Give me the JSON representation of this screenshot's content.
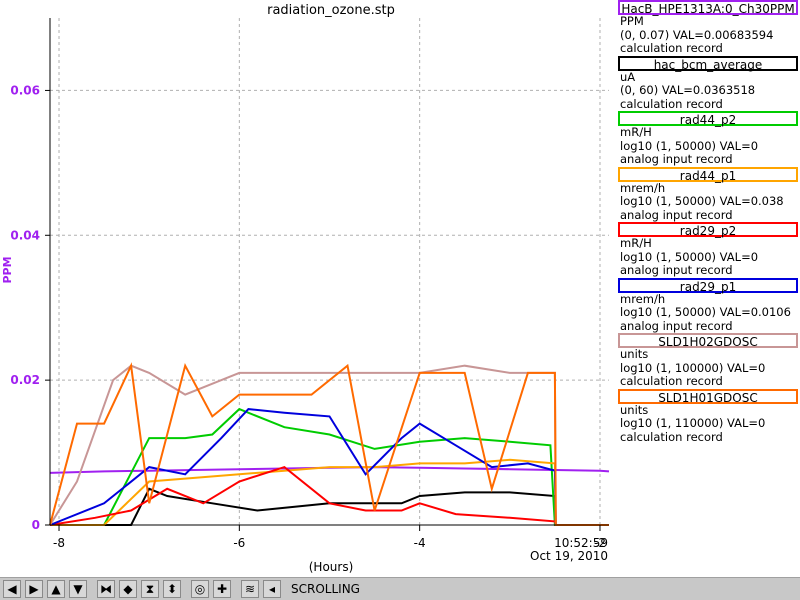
{
  "chart_data": {
    "type": "line",
    "title": "radiation_ozone.stp",
    "xlabel": "(Hours)",
    "ylabel": "PPM",
    "xlim": [
      -8.1,
      -1.9
    ],
    "ylim": [
      0,
      0.07
    ],
    "x_ticks": [
      -8,
      -6,
      -4,
      -2
    ],
    "x_tick_labels": [
      "-8",
      "-6",
      "-4",
      "-2"
    ],
    "y_ticks": [
      0,
      0.02,
      0.04,
      0.06
    ],
    "y_tick_labels": [
      "0",
      "0.02",
      "0.04",
      "0.06"
    ],
    "time_label": "10:52:59",
    "date_label": "Oct 19, 2010",
    "grid": true,
    "legend_position": "right",
    "series": [
      {
        "name": "HacB_HPE1313A:0_Ch30PPM",
        "color": "#a020f0",
        "x": [
          -8.1,
          -7.5,
          -7.0,
          -6.5,
          -6.0,
          -5.5,
          -5.0,
          -4.5,
          -4.0,
          -3.5,
          -3.0,
          -2.5,
          -2.0,
          -1.9
        ],
        "y": [
          0.0072,
          0.0074,
          0.0075,
          0.0076,
          0.0077,
          0.0078,
          0.0079,
          0.008,
          0.0079,
          0.0078,
          0.0077,
          0.0076,
          0.0075,
          0.0074
        ]
      },
      {
        "name": "hac_bcm_average",
        "color": "#000000",
        "x": [
          -8.1,
          -7.2,
          -7.0,
          -6.8,
          -6.3,
          -5.8,
          -5.0,
          -4.2,
          -4.0,
          -3.5,
          -3.0,
          -2.5,
          -2.49,
          -1.9
        ],
        "y": [
          0.0,
          0.0,
          0.005,
          0.004,
          0.003,
          0.002,
          0.003,
          0.003,
          0.004,
          0.0045,
          0.0045,
          0.004,
          0.0,
          0.0
        ]
      },
      {
        "name": "rad44_p2",
        "color": "#00cc00",
        "x": [
          -8.1,
          -7.5,
          -7.0,
          -6.6,
          -6.3,
          -6.0,
          -5.5,
          -5.0,
          -4.5,
          -4.0,
          -3.5,
          -3.0,
          -2.55,
          -2.5,
          -1.9
        ],
        "y": [
          0.0,
          0.0,
          0.012,
          0.012,
          0.0125,
          0.016,
          0.0135,
          0.0125,
          0.0105,
          0.0115,
          0.012,
          0.0115,
          0.011,
          0.0,
          0.0
        ]
      },
      {
        "name": "rad44_p1",
        "color": "#ffa500",
        "x": [
          -8.1,
          -7.5,
          -7.0,
          -6.5,
          -6.0,
          -5.5,
          -5.0,
          -4.5,
          -4.0,
          -3.5,
          -3.0,
          -2.5,
          -2.49,
          -1.9
        ],
        "y": [
          0.0,
          0.0,
          0.006,
          0.0065,
          0.007,
          0.0075,
          0.008,
          0.008,
          0.0085,
          0.0085,
          0.009,
          0.0085,
          0.0,
          0.0
        ]
      },
      {
        "name": "rad29_p2",
        "color": "#ff0000",
        "x": [
          -8.1,
          -7.6,
          -7.2,
          -6.8,
          -6.4,
          -6.0,
          -5.5,
          -5.0,
          -4.6,
          -4.2,
          -4.0,
          -3.6,
          -3.0,
          -2.5,
          -2.49,
          -1.9
        ],
        "y": [
          0.0,
          0.001,
          0.002,
          0.005,
          0.003,
          0.006,
          0.008,
          0.003,
          0.002,
          0.002,
          0.003,
          0.0015,
          0.001,
          0.0005,
          0.0,
          0.0
        ]
      },
      {
        "name": "rad29_p1",
        "color": "#0000dd",
        "x": [
          -8.1,
          -7.5,
          -7.0,
          -6.6,
          -6.2,
          -5.9,
          -5.5,
          -5.0,
          -4.6,
          -4.2,
          -4.0,
          -3.6,
          -3.2,
          -2.8,
          -2.5,
          -2.49,
          -1.9
        ],
        "y": [
          0.0,
          0.003,
          0.008,
          0.007,
          0.012,
          0.016,
          0.0155,
          0.015,
          0.007,
          0.012,
          0.014,
          0.011,
          0.008,
          0.0085,
          0.0075,
          0.0,
          0.0
        ]
      },
      {
        "name": "SLD1H02GDOSC",
        "color": "#c89696",
        "x": [
          -8.1,
          -7.8,
          -7.4,
          -7.2,
          -7.0,
          -6.6,
          -6.0,
          -5.5,
          -5.0,
          -4.5,
          -4.0,
          -3.5,
          -3.0,
          -2.5,
          -2.49,
          -1.9
        ],
        "y": [
          0.0,
          0.006,
          0.02,
          0.022,
          0.021,
          0.018,
          0.021,
          0.021,
          0.021,
          0.021,
          0.021,
          0.022,
          0.021,
          0.021,
          0.0,
          0.0
        ]
      },
      {
        "name": "SLD1H01GDOSC",
        "color": "#ff6a00",
        "x": [
          -8.1,
          -7.8,
          -7.5,
          -7.2,
          -7.0,
          -6.6,
          -6.3,
          -6.0,
          -5.6,
          -5.2,
          -4.8,
          -4.5,
          -4.0,
          -3.8,
          -3.5,
          -3.2,
          -2.8,
          -2.5,
          -2.49,
          -1.9
        ],
        "y": [
          0.0,
          0.014,
          0.014,
          0.022,
          0.003,
          0.022,
          0.015,
          0.018,
          0.018,
          0.018,
          0.022,
          0.002,
          0.021,
          0.021,
          0.021,
          0.005,
          0.021,
          0.021,
          0.0,
          0.0
        ]
      }
    ]
  },
  "legend": [
    {
      "name": "HacB_HPE1313A:0_Ch30PPM",
      "units": "PPM",
      "range": "(0, 0.07) VAL=0.00683594",
      "record": "calculation record",
      "color": "#a020f0"
    },
    {
      "name": "hac_bcm_average",
      "units": "uA",
      "range": "(0, 60) VAL=0.0363518",
      "record": "calculation record",
      "color": "#000000"
    },
    {
      "name": "rad44_p2",
      "units": "mR/H",
      "range": "log10 (1, 50000) VAL=0",
      "record": "analog input record",
      "color": "#00cc00"
    },
    {
      "name": "rad44_p1",
      "units": "mrem/h",
      "range": "log10 (1, 50000) VAL=0.038",
      "record": "analog input record",
      "color": "#ffa500"
    },
    {
      "name": "rad29_p2",
      "units": "mR/H",
      "range": "log10 (1, 50000) VAL=0",
      "record": "analog input record",
      "color": "#ff0000"
    },
    {
      "name": "rad29_p1",
      "units": "mrem/h",
      "range": "log10 (1, 50000) VAL=0.0106",
      "record": "analog input record",
      "color": "#0000dd"
    },
    {
      "name": "SLD1H02GDOSC",
      "units": "units",
      "range": "log10 (1, 100000) VAL=0",
      "record": "calculation record",
      "color": "#c89696"
    },
    {
      "name": "SLD1H01GDOSC",
      "units": "units",
      "range": "log10 (1, 110000) VAL=0",
      "record": "calculation record",
      "color": "#ff6a00"
    }
  ],
  "toolbar": {
    "buttons": [
      "arrow-left-icon",
      "arrow-right-icon",
      "arrow-up-icon",
      "arrow-down-icon",
      "zoom-in-x-icon",
      "zoom-out-x-icon",
      "zoom-in-y-icon",
      "zoom-out-y-icon",
      "autoscale-icon",
      "add-icon",
      "config-icon",
      "back-icon"
    ],
    "glyphs": [
      "◀",
      "▶",
      "▲",
      "▼",
      "⧓",
      "◆",
      "⧗",
      "⬍",
      "◎",
      "✚",
      "≋",
      "◂"
    ],
    "status": "SCROLLING"
  }
}
